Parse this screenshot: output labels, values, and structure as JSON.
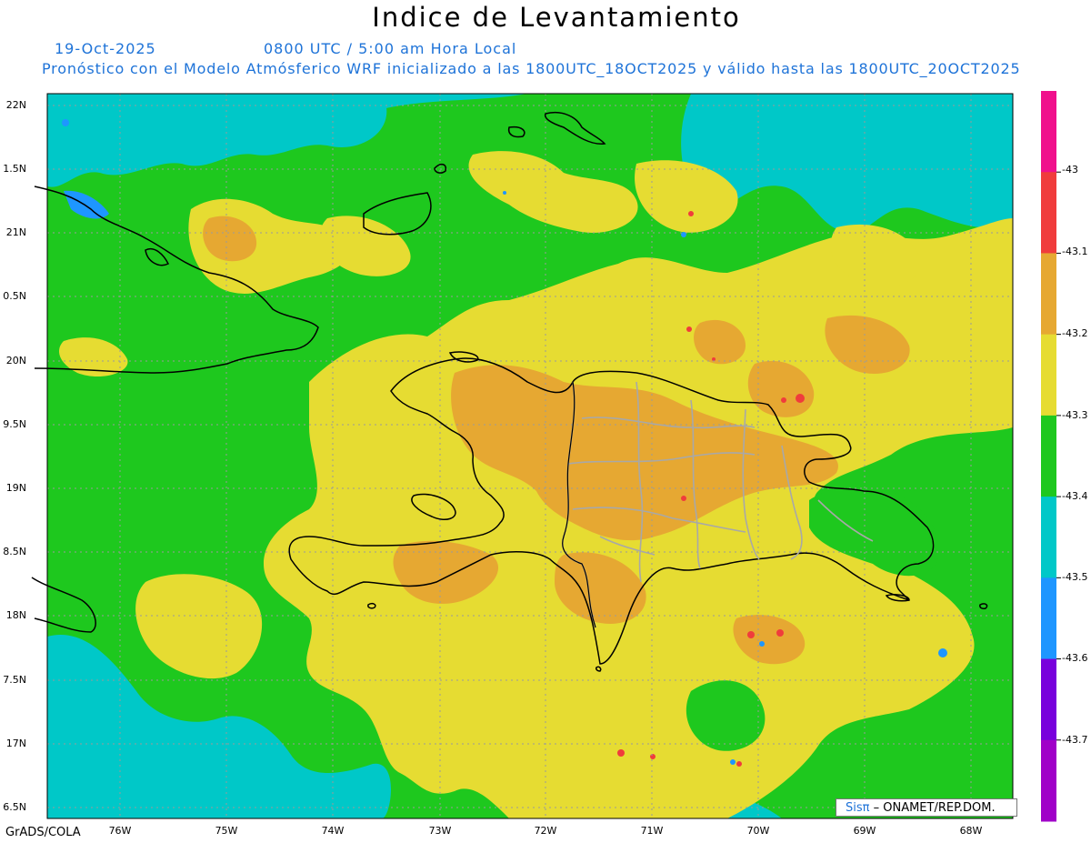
{
  "title": "Indice de Levantamiento",
  "date": "19-Oct-2025",
  "valid_time": "0800 UTC / 5:00 am Hora Local",
  "forecast_line": "Pronóstico con el Modelo Atmósferico WRF inicializado a las 1800UTC_18OCT2025 y válido hasta las  1800UTC_20OCT2025",
  "lat_labels": [
    "22N",
    "1.5N",
    "21N",
    "0.5N",
    "20N",
    "9.5N",
    "19N",
    "8.5N",
    "18N",
    "7.5N",
    "17N",
    "6.5N"
  ],
  "lon_labels": [
    "76W",
    "75W",
    "74W",
    "73W",
    "72W",
    "71W",
    "70W",
    "69W",
    "68W"
  ],
  "colorbar": {
    "labels": [
      "-43",
      "-43.1",
      "-43.2",
      "-43.3",
      "-43.4",
      "-43.5",
      "-43.6",
      "-43.7"
    ],
    "colors": [
      "#f0108c",
      "#f03c3c",
      "#e6a832",
      "#e6dc32",
      "#1ec81e",
      "#00c8c8",
      "#1e96ff",
      "#7800dc",
      "#a000c8"
    ]
  },
  "credit": {
    "logo": "Sisπ",
    "text": " – ONAMET/REP.DOM."
  },
  "footer": "GrADS/COLA"
}
